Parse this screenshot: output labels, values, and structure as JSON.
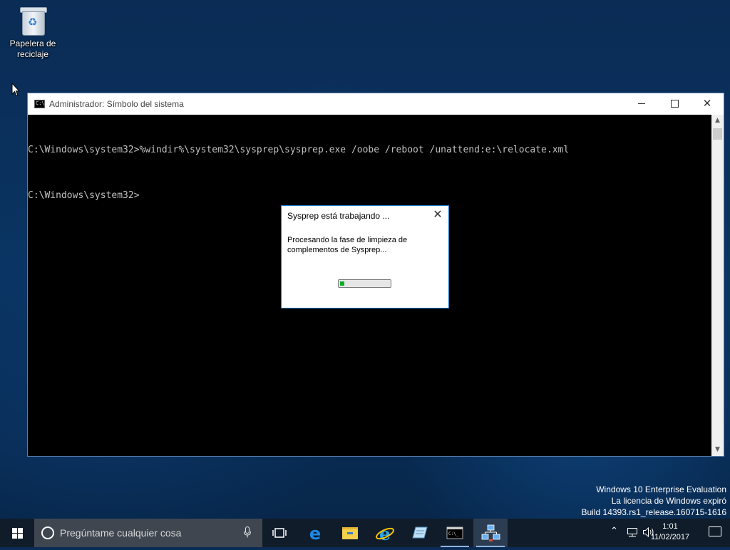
{
  "desktop": {
    "recycle_bin_label": "Papelera de reciclaje"
  },
  "console": {
    "title": "Administrador: Símbolo del sistema",
    "icon_text": "C:\\",
    "lines": [
      "C:\\Windows\\system32>%windir%\\system32\\sysprep\\sysprep.exe /oobe /reboot /unattend:e:\\relocate.xml",
      "C:\\Windows\\system32>"
    ]
  },
  "dialog": {
    "title": "Sysprep está trabajando ...",
    "message": "Procesando la fase de limpieza de complementos de Sysprep...",
    "progress": 0.08
  },
  "watermark": {
    "line1": "Windows 10 Enterprise Evaluation",
    "line2": "La licencia de Windows expiró",
    "line3": "Build 14393.rs1_release.160715-1616"
  },
  "taskbar": {
    "search_placeholder": "Pregúntame cualquier cosa",
    "apps": [
      "task-view",
      "edge",
      "file-explorer",
      "internet-explorer",
      "notepad",
      "command-prompt",
      "network"
    ],
    "time": "1:01",
    "date": "11/02/2017"
  },
  "colors": {
    "progress_fill": "#06b025",
    "dialog_border": "#1979ca"
  }
}
